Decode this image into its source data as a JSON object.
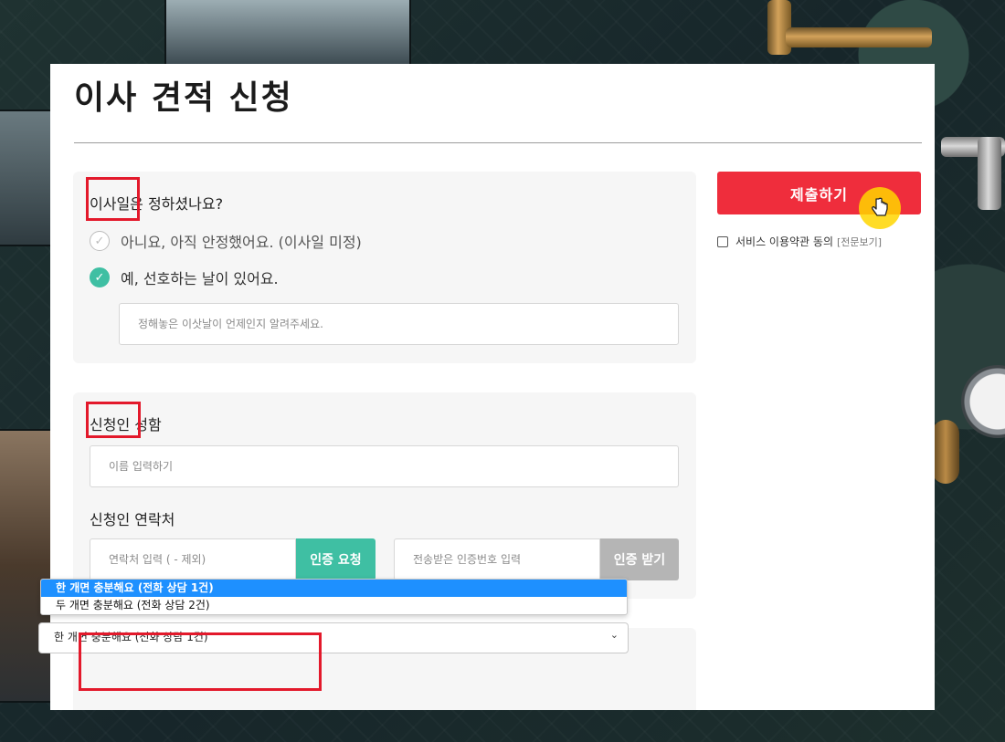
{
  "page": {
    "title": "이사 견적 신청"
  },
  "move_date": {
    "question": "이사일은 정하셨나요?",
    "options": [
      {
        "label": "아니요, 아직 안정했어요. (이사일 미정)",
        "checked": false
      },
      {
        "label": "예, 선호하는 날이 있어요.",
        "checked": true
      }
    ],
    "date_placeholder": "정해놓은 이삿날이 언제인지 알려주세요."
  },
  "applicant": {
    "name_label": "신청인 성함",
    "name_placeholder": "이름 입력하기",
    "phone_label": "신청인 연락처",
    "phone_placeholder": "연락처 입력 ( - 제외)",
    "request_button": "인증 요청",
    "code_placeholder": "전송받은 인증번호 입력",
    "receive_button": "인증 받기"
  },
  "consult": {
    "dropdown_options": [
      "한 개면 충분해요 (전화 상담 1건)",
      "두 개면 충분해요 (전화 상담 2건)"
    ],
    "selected": "한 개면 충분해요 (전화 상담 1건)"
  },
  "sidebar": {
    "submit_label": "제출하기",
    "terms_label": "서비스 이용약관 동의",
    "terms_full": "[전문보기]"
  },
  "colors": {
    "accent_green": "#3fbfa3",
    "submit_red": "#ef2d3c",
    "annotation_red": "#e3192b",
    "dropdown_highlight": "#1e90ff"
  },
  "icons": {
    "check": "check-icon",
    "chevron": "chevron-down-icon",
    "cursor": "hand-pointer-icon"
  }
}
